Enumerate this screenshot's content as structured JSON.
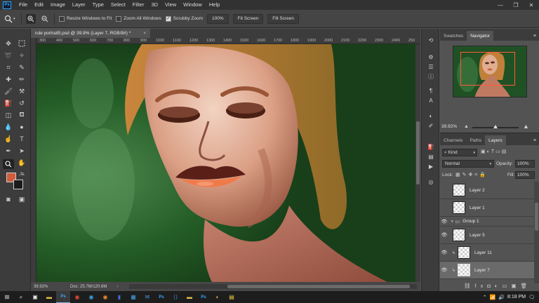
{
  "app": {
    "logo": "Ps"
  },
  "menu": [
    "File",
    "Edit",
    "Image",
    "Layer",
    "Type",
    "Select",
    "Filter",
    "3D",
    "View",
    "Window",
    "Help"
  ],
  "window_controls": {
    "minimize": "—",
    "restore": "❐",
    "close": "✕"
  },
  "options_bar": {
    "zoom_in_icon": "zoom-in-icon",
    "zoom_out_icon": "zoom-out-icon",
    "resize_windows_label": "Resize Windows to Fit",
    "zoom_all_label": "Zoom All Windows",
    "scrubby_zoom_label": "Scrubby Zoom",
    "scrubby_zoom_checked": true,
    "zoom_value": "100%",
    "fit_screen_label": "Fit Screen",
    "fill_screen_label": "Fill Screen"
  },
  "document": {
    "tab_title": "rule portrait5.psd @ 39.9% (Layer 7, RGB/8#) *",
    "tab_close": "×",
    "ruler_ticks": [
      "300",
      "400",
      "500",
      "600",
      "700",
      "800",
      "900",
      "1000",
      "1100",
      "1200",
      "1300",
      "1400",
      "1500",
      "1600",
      "1700",
      "1800",
      "1900",
      "2000",
      "2100",
      "2200",
      "2300",
      "2400",
      "250"
    ],
    "zoom_status": "39.92%",
    "doc_status": "Doc: 25.7M/120.6M"
  },
  "colors": {
    "foreground": "#d05c3c",
    "background": "#1a1a1a",
    "accent": "#31a8ff",
    "nav_frame": "#ff5a3a"
  },
  "navigator": {
    "tabs": [
      "Swatches",
      "Navigator"
    ],
    "active_tab": "Navigator",
    "zoom": "39.92%"
  },
  "layers_panel": {
    "tabs": [
      "Channels",
      "Paths",
      "Layers"
    ],
    "active_tab": "Layers",
    "filter_label": "Kind",
    "blend_mode": "Normal",
    "opacity_label": "Opacity:",
    "opacity_value": "100%",
    "lock_label": "Lock:",
    "fill_label": "Fill:",
    "fill_value": "100%",
    "layers": [
      {
        "name": "Layer 2",
        "visible": false,
        "type": "layer"
      },
      {
        "name": "Layer 1",
        "visible": false,
        "type": "layer"
      },
      {
        "name": "Group 1",
        "visible": true,
        "type": "group"
      },
      {
        "name": "Layer 5",
        "visible": true,
        "type": "layer"
      },
      {
        "name": "Layer 11",
        "visible": true,
        "type": "clip"
      },
      {
        "name": "Layer 7",
        "visible": true,
        "type": "clip",
        "selected": true
      }
    ]
  },
  "taskbar": {
    "clock": "8:18 PM",
    "apps": [
      "start",
      "search",
      "task-view",
      "file-explorer",
      "photoshop",
      "chrome",
      "edge",
      "firefox",
      "word",
      "store",
      "mail",
      "photoshop-2",
      "vscode",
      "files",
      "photoshop-3",
      "paint",
      "notes"
    ]
  }
}
